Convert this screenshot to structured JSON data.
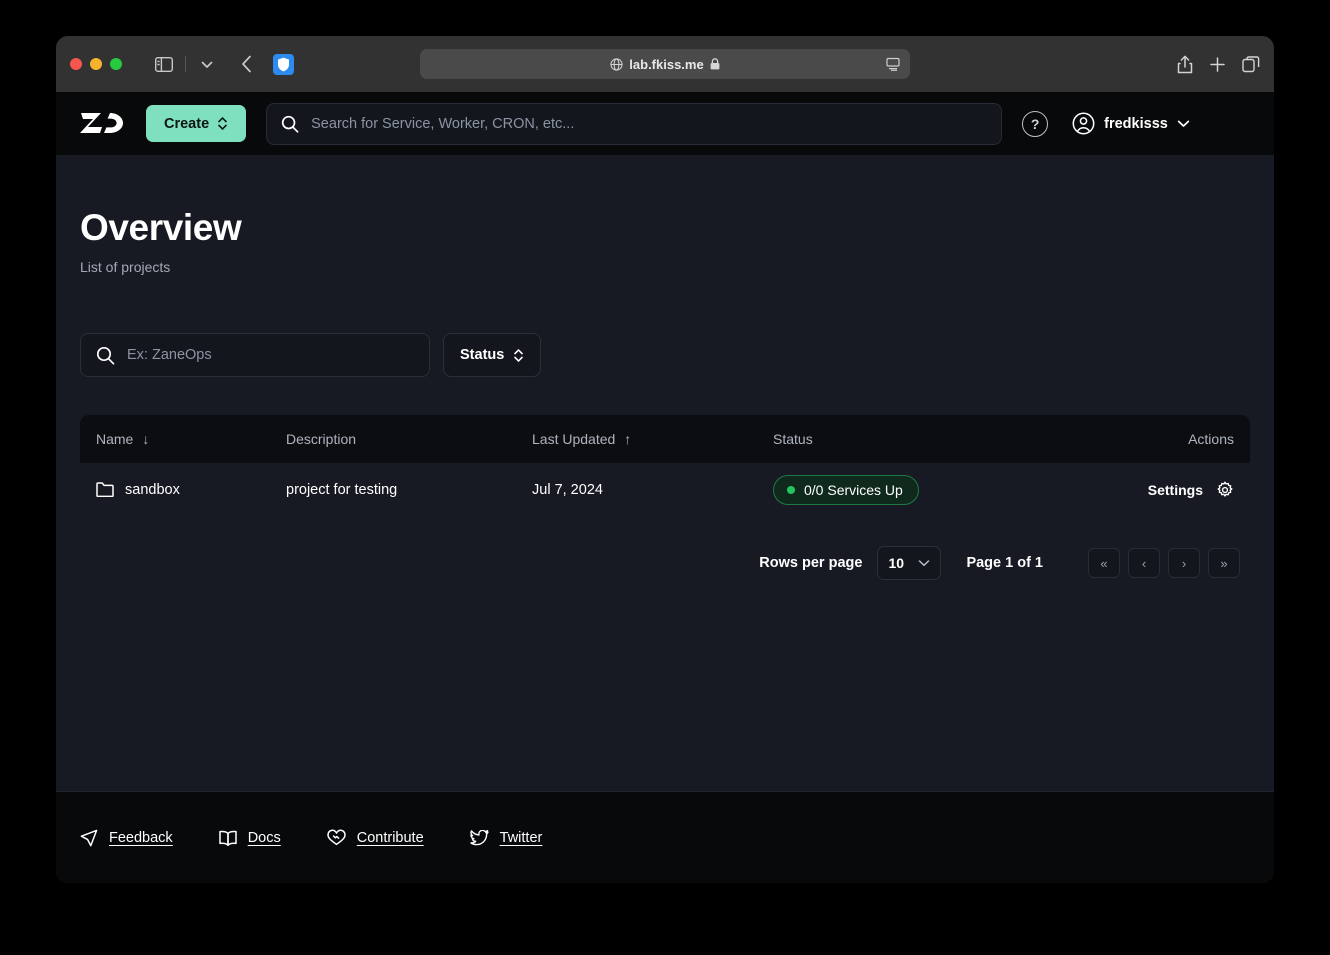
{
  "browser": {
    "url": "lab.fkiss.me",
    "icons": {
      "globe": "globe-icon",
      "lock": "lock-icon",
      "reader": "reader-view-icon",
      "sidebar": "sidebar-toggle-icon",
      "chevron_down": "chevron-down-icon",
      "back": "back-arrow-icon",
      "extension": "shield-extension-icon",
      "share": "share-icon",
      "new_tab": "plus-icon",
      "tabs": "tab-overview-icon"
    }
  },
  "app_header": {
    "logo": "ZO",
    "create_label": "Create",
    "search_placeholder": "Search for Service, Worker, CRON, etc...",
    "search_value": "",
    "help_label": "?",
    "username": "fredkisss"
  },
  "page": {
    "title": "Overview",
    "subtitle": "List of projects"
  },
  "filters": {
    "search_placeholder": "Ex: ZaneOps",
    "search_value": "",
    "status_label": "Status"
  },
  "table": {
    "columns": [
      {
        "label": "Name",
        "sort": "↓"
      },
      {
        "label": "Description",
        "sort": ""
      },
      {
        "label": "Last Updated",
        "sort": "↑"
      },
      {
        "label": "Status",
        "sort": ""
      },
      {
        "label": "Actions",
        "sort": ""
      }
    ],
    "rows": [
      {
        "name": "sandbox",
        "description": "project for testing",
        "last_updated": "Jul 7, 2024",
        "status": "0/0 Services Up",
        "action_label": "Settings"
      }
    ]
  },
  "pagination": {
    "rows_per_page_label": "Rows per page",
    "rows_per_page_value": "10",
    "page_label": "Page 1 of 1",
    "first_label": "«",
    "prev_label": "‹",
    "next_label": "›",
    "last_label": "»"
  },
  "footer": {
    "links": [
      {
        "label": "Feedback",
        "icon": "send-icon"
      },
      {
        "label": "Docs",
        "icon": "book-icon"
      },
      {
        "label": "Contribute",
        "icon": "heart-handshake-icon"
      },
      {
        "label": "Twitter",
        "icon": "twitter-bird-icon"
      }
    ]
  },
  "colors": {
    "accent_green": "#7fe0c0",
    "status_green": "#22c55e",
    "page_bg": "#171a22",
    "header_bg": "#08090b"
  }
}
